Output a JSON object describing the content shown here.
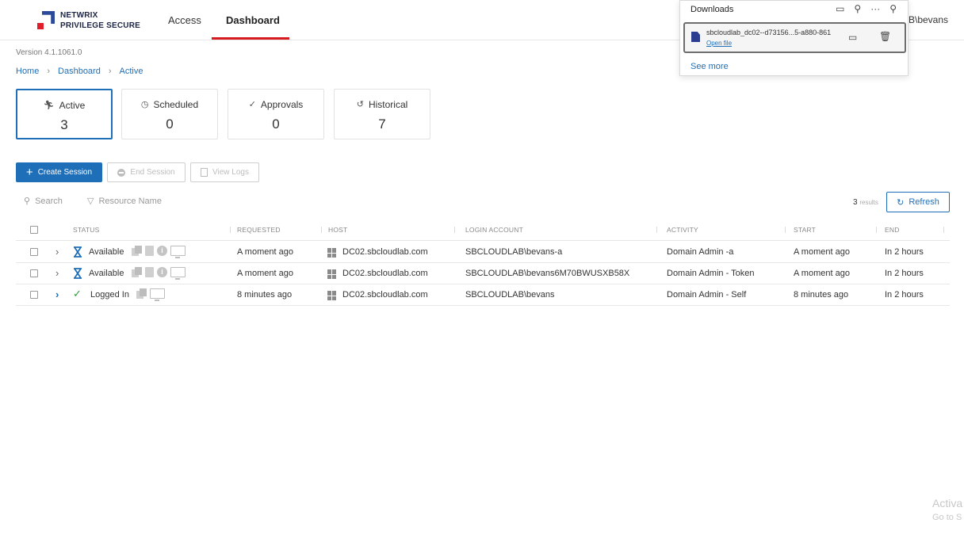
{
  "header": {
    "logo_line1": "NETWRIX",
    "logo_line2": "PRIVILEGE SECURE",
    "tabs": [
      {
        "label": "Access"
      },
      {
        "label": "Dashboard",
        "active": true
      }
    ],
    "user": "B\\bevans",
    "accent_color": "#d71920"
  },
  "version": "Version 4.1.1061.0",
  "breadcrumb": [
    "Home",
    "Dashboard",
    "Active"
  ],
  "cards": [
    {
      "label": "Active",
      "count": "3",
      "icon": "running-person-icon",
      "active": true
    },
    {
      "label": "Scheduled",
      "count": "0",
      "icon": "clock-icon"
    },
    {
      "label": "Approvals",
      "count": "0",
      "icon": "checkmark-icon"
    },
    {
      "label": "Historical",
      "count": "7",
      "icon": "history-icon"
    }
  ],
  "toolbar": {
    "create_label": "Create Session",
    "end_label": "End Session",
    "logs_label": "View Logs"
  },
  "filters": {
    "search_label": "Search",
    "resource_label": "Resource Name"
  },
  "results": {
    "count": "3",
    "label": "results"
  },
  "refresh_label": "Refresh",
  "table": {
    "headers": [
      "STATUS",
      "REQUESTED",
      "HOST",
      "LOGIN ACCOUNT",
      "ACTIVITY",
      "START",
      "END"
    ],
    "rows": [
      {
        "status": "Available",
        "requested": "A moment ago",
        "host": "DC02.sbcloudlab.com",
        "login": "SBCLOUDLAB\\bevans-a",
        "activity": "Domain Admin -a",
        "start": "A moment ago",
        "end": "In 2 hours"
      },
      {
        "status": "Available",
        "requested": "A moment ago",
        "host": "DC02.sbcloudlab.com",
        "login": "SBCLOUDLAB\\bevans6M70BWUSXB58X",
        "activity": "Domain Admin - Token",
        "start": "A moment ago",
        "end": "In 2 hours"
      },
      {
        "status": "Logged In",
        "requested": "8 minutes ago",
        "host": "DC02.sbcloudlab.com",
        "login": "SBCLOUDLAB\\bevans",
        "activity": "Domain Admin - Self",
        "start": "8 minutes ago",
        "end": "In 2 hours"
      }
    ]
  },
  "downloads": {
    "title": "Downloads",
    "file_name": "sbcloudlab_dc02--d73156...5-a880-861",
    "open_file": "Open file",
    "see_more": "See more"
  },
  "watermark": {
    "line1": "Activa",
    "line2": "Go to S"
  }
}
